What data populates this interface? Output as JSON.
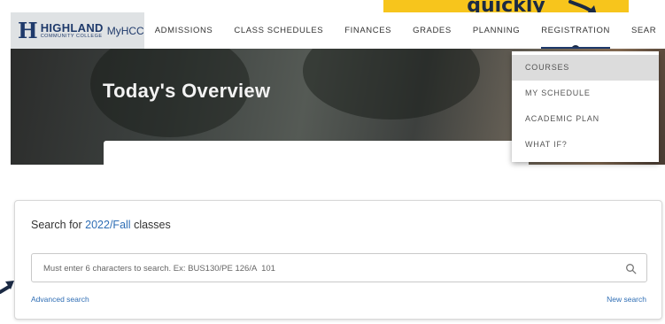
{
  "callout": {
    "text": "quickly"
  },
  "logo": {
    "letter": "H",
    "name": "HIGHLAND",
    "subtitle": "COMMUNITY COLLEGE",
    "app": "MyHCC"
  },
  "nav": {
    "items": [
      {
        "label": "ADMISSIONS"
      },
      {
        "label": "CLASS SCHEDULES"
      },
      {
        "label": "FINANCES"
      },
      {
        "label": "GRADES"
      },
      {
        "label": "PLANNING"
      },
      {
        "label": "REGISTRATION"
      },
      {
        "label": "SEAR"
      }
    ]
  },
  "hero": {
    "title": "Today's Overview"
  },
  "dropdown": {
    "items": [
      {
        "label": "COURSES"
      },
      {
        "label": "MY SCHEDULE"
      },
      {
        "label": "ACADEMIC PLAN"
      },
      {
        "label": "WHAT IF?"
      }
    ]
  },
  "search": {
    "heading_prefix": "Search for",
    "term": "2022/Fall",
    "heading_suffix": "classes",
    "placeholder": "Must enter 6 characters to search. Ex: BUS130/PE 126/A  101",
    "advanced_label": "Advanced search",
    "new_label": "New search"
  },
  "colors": {
    "brand_navy": "#1f3a6b",
    "link_blue": "#2f6eb5",
    "callout_yellow": "#f7c51c"
  }
}
